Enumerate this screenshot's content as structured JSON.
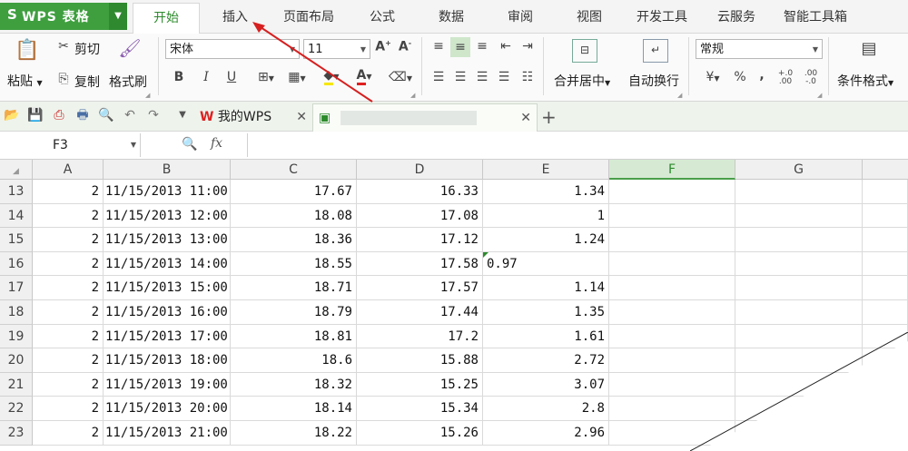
{
  "app": {
    "logo": "S",
    "title": "WPS 表格"
  },
  "tabs": [
    "开始",
    "插入",
    "页面布局",
    "公式",
    "数据",
    "审阅",
    "视图",
    "开发工具",
    "云服务",
    "智能工具箱"
  ],
  "ribbon": {
    "paste": "粘贴",
    "cut": "剪切",
    "copy": "复制",
    "format_painter": "格式刷",
    "font_name": "宋体",
    "font_size": "11",
    "bold": "B",
    "italic": "I",
    "underline": "U",
    "merge_center": "合并居中",
    "wrap_text": "自动换行",
    "number_format": "常规",
    "percent": "%",
    "comma": ",",
    "cond_format": "条件格式"
  },
  "docs": {
    "my_wps": "我的WPS"
  },
  "formula_bar": {
    "cell_ref": "F3",
    "fx": "fx"
  },
  "sheet": {
    "columns": [
      "A",
      "B",
      "C",
      "D",
      "E",
      "F",
      "G"
    ],
    "rows": [
      {
        "n": "13",
        "a": "2",
        "b": "11/15/2013 11:00",
        "c": "17.67",
        "d": "16.33",
        "e": "1.34"
      },
      {
        "n": "14",
        "a": "2",
        "b": "11/15/2013 12:00",
        "c": "18.08",
        "d": "17.08",
        "e": "1"
      },
      {
        "n": "15",
        "a": "2",
        "b": "11/15/2013 13:00",
        "c": "18.36",
        "d": "17.12",
        "e": "1.24"
      },
      {
        "n": "16",
        "a": "2",
        "b": "11/15/2013 14:00",
        "c": "18.55",
        "d": "17.58",
        "e": "0.97"
      },
      {
        "n": "17",
        "a": "2",
        "b": "11/15/2013 15:00",
        "c": "18.71",
        "d": "17.57",
        "e": "1.14"
      },
      {
        "n": "18",
        "a": "2",
        "b": "11/15/2013 16:00",
        "c": "18.79",
        "d": "17.44",
        "e": "1.35"
      },
      {
        "n": "19",
        "a": "2",
        "b": "11/15/2013 17:00",
        "c": "18.81",
        "d": "17.2",
        "e": "1.61"
      },
      {
        "n": "20",
        "a": "2",
        "b": "11/15/2013 18:00",
        "c": "18.6",
        "d": "15.88",
        "e": "2.72"
      },
      {
        "n": "21",
        "a": "2",
        "b": "11/15/2013 19:00",
        "c": "18.32",
        "d": "15.25",
        "e": "3.07"
      },
      {
        "n": "22",
        "a": "2",
        "b": "11/15/2013 20:00",
        "c": "18.14",
        "d": "15.34",
        "e": "2.8"
      },
      {
        "n": "23",
        "a": "2",
        "b": "11/15/2013 21:00",
        "c": "18.22",
        "d": "15.26",
        "e": "2.96"
      }
    ]
  },
  "colors": {
    "brand": "#3f9f3f",
    "arrow": "#d62020",
    "selected_col": "#d6ead3"
  }
}
